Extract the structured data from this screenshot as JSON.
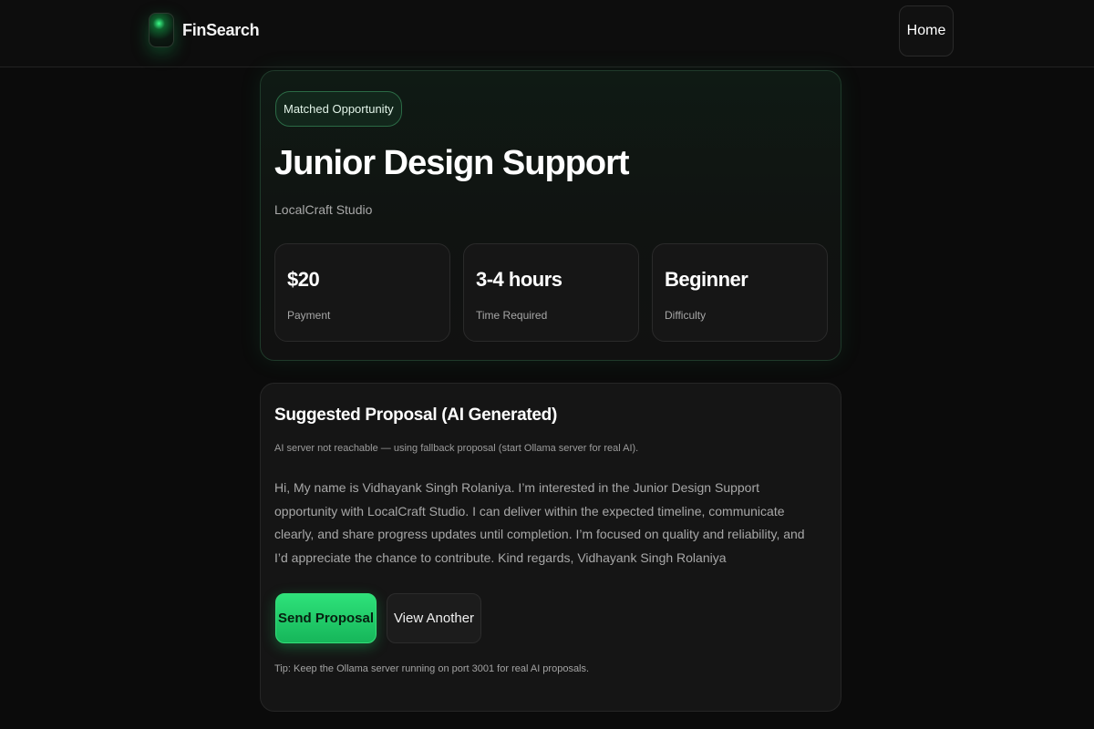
{
  "navbar": {
    "brand_name": "FinSearch",
    "logo_icon": "finsearch-logo-icon",
    "home_label": "Home"
  },
  "job": {
    "badge": "Matched Opportunity",
    "title": "Junior Design Support",
    "company": "LocalCraft Studio",
    "stats": [
      {
        "value": "$20",
        "label": "Payment"
      },
      {
        "value": "3-4 hours",
        "label": "Time Required"
      },
      {
        "value": "Beginner",
        "label": "Difficulty"
      }
    ]
  },
  "proposal": {
    "title": "Suggested Proposal (AI Generated)",
    "status": "AI server not reachable — using fallback proposal (start Ollama server for real AI).",
    "text": "Hi, My name is Vidhayank Singh Rolaniya. I’m interested in the Junior Design Support opportunity with LocalCraft Studio. I can deliver within the expected timeline, communicate clearly, and share progress updates until completion. I’m focused on quality and reliability, and I’d appreciate the chance to contribute. Kind regards, Vidhayank Singh Rolaniya",
    "send_label": "Send Proposal",
    "view_another_label": "View Another",
    "tip": "Tip: Keep the Ollama server running on port 3001 for real AI proposals."
  },
  "colors": {
    "background": "#0b0b0b",
    "accent": "#22c96a",
    "card": "#151515"
  }
}
